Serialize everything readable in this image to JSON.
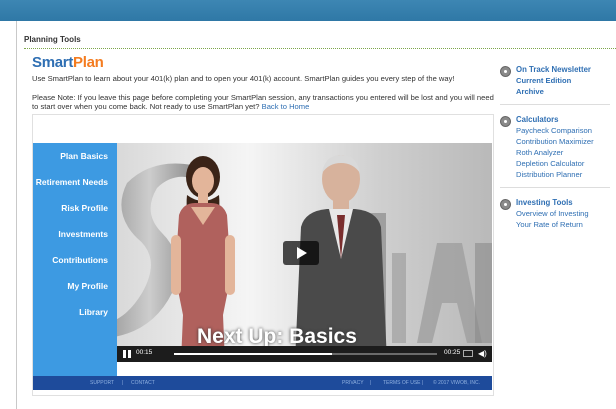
{
  "page": {
    "section_title": "Planning Tools",
    "logo": {
      "smart": "Smart",
      "plan": "Plan"
    },
    "intro": "Use SmartPlan to learn about your 401(k) plan and to open your 401(k) account. SmartPlan guides you every step of the way!",
    "note": "Please Note: If you leave this page before completing your SmartPlan session, any transactions you entered will be lost and you will need to start over when you come back. Not ready to use SmartPlan yet?",
    "back_link": "Back to Home"
  },
  "nav": {
    "items": [
      "Plan Basics",
      "Retirement Needs",
      "Risk Profile",
      "Investments",
      "Contributions",
      "My Profile",
      "Library"
    ]
  },
  "video": {
    "overlay_title": "Next Up: Basics",
    "current_time": "00:15",
    "duration": "00:25",
    "progress": 0.6
  },
  "footer": {
    "support": "SUPPORT",
    "contact": "CONTACT",
    "privacy": "PRIVACY",
    "terms": "TERMS OF USE",
    "copyright": "© 2017 VIWOB, INC."
  },
  "right": {
    "newsletter": {
      "title": "On Track Newsletter",
      "links": [
        "Current Edition",
        "Archive"
      ]
    },
    "calculators": {
      "title": "Calculators",
      "links": [
        "Paycheck Comparison",
        "Contribution Maximizer",
        "Roth Analyzer",
        "Depletion Calculator",
        "Distribution Planner"
      ]
    },
    "investing": {
      "title": "Investing Tools",
      "links": [
        "Overview of Investing",
        "Your Rate of Return"
      ]
    }
  },
  "colors": {
    "accent": "#2f6fb3",
    "brand_orange": "#f47c20",
    "nav_blue": "#3d9ae2",
    "footer_blue": "#1e4b9b"
  }
}
